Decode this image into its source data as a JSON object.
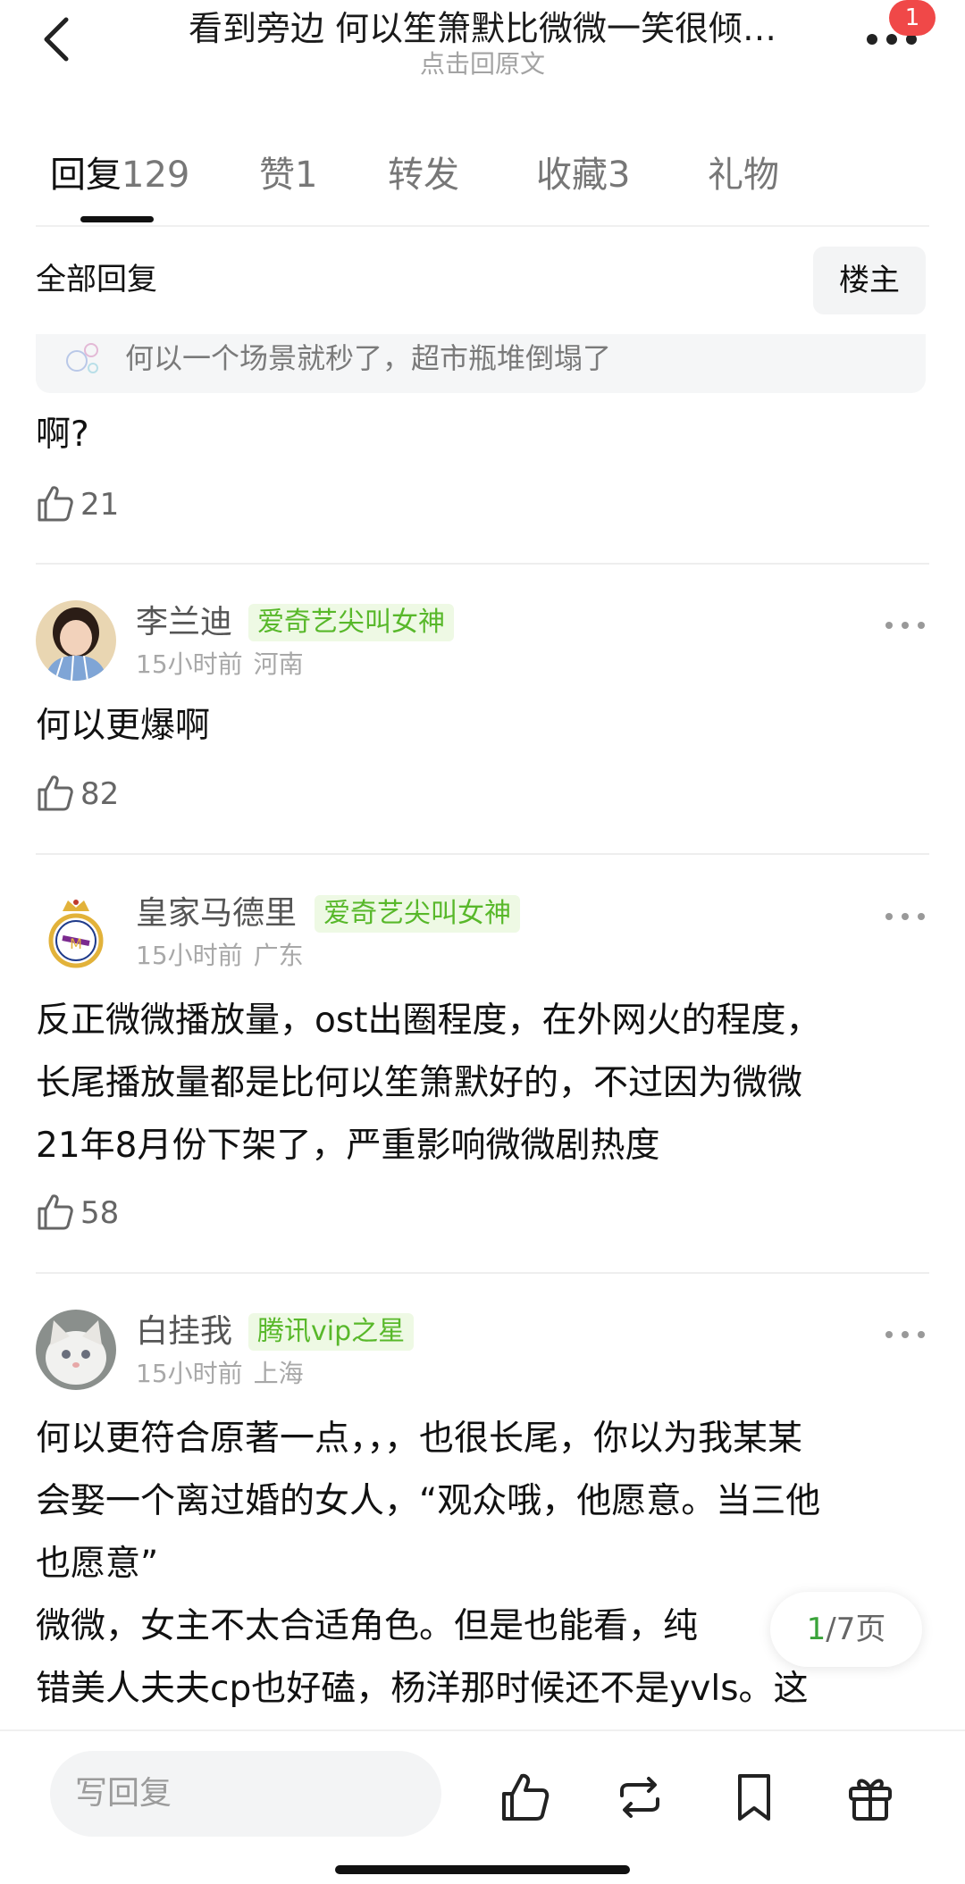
{
  "header": {
    "title": "看到旁边 何以笙箫默比微微一笑很倾…",
    "subtitle": "点击回原文",
    "badge_count": "1",
    "back_icon": "chevron-left-icon",
    "more_icon": "more-dots-icon"
  },
  "tabs": [
    {
      "label": "回复",
      "count": "129",
      "active": true
    },
    {
      "label": "赞",
      "count": "1",
      "active": false
    },
    {
      "label": "转发",
      "count": "",
      "active": false
    },
    {
      "label": "收藏",
      "count": "3",
      "active": false
    },
    {
      "label": "礼物",
      "count": "",
      "active": false
    }
  ],
  "replies_header": {
    "label": "全部回复",
    "op_filter": "楼主"
  },
  "quote": {
    "text": "何以一个场景就秒了，超市瓶堆倒塌了"
  },
  "first_comment": {
    "text": "啊?",
    "likes": "21"
  },
  "comments": [
    {
      "username": "李兰迪",
      "tag": "爱奇艺尖叫女神",
      "time": "15小时前",
      "location": "河南",
      "text": "何以更爆啊",
      "likes": "82"
    },
    {
      "username": "皇家马德里",
      "tag": "爱奇艺尖叫女神",
      "time": "15小时前",
      "location": "广东",
      "text_lines": [
        "反正微微播放量，ost出圈程度，在外网火的程度，",
        "长尾播放量都是比何以笙箫默好的，不过因为微微",
        "21年8月份下架了，严重影响微微剧热度"
      ],
      "likes": "58"
    },
    {
      "username": "白挂我",
      "tag": "腾讯vip之星",
      "time": "15小时前",
      "location": "上海",
      "text_lines": [
        "何以更符合原著一点，，，也很长尾，你以为我某某",
        "会娶一个离过婚的女人，“观众哦，他愿意。当三他",
        "也愿意”",
        "微微，女主不太合适角色。但是也能看，纯",
        "错美人夫夫cp也好磕，杨洋那时候还不是yvls。这"
      ]
    }
  ],
  "pager": {
    "current": "1",
    "total": "/7页"
  },
  "bottom_bar": {
    "reply_placeholder": "写回复",
    "icons": [
      "thumbs-up-icon",
      "repost-icon",
      "bookmark-icon",
      "gift-icon"
    ]
  },
  "colors": {
    "tag_green": "#58b82a",
    "tag_bg": "#eef9e4",
    "badge_red": "#f04848",
    "pager_green": "#3aa33a"
  }
}
